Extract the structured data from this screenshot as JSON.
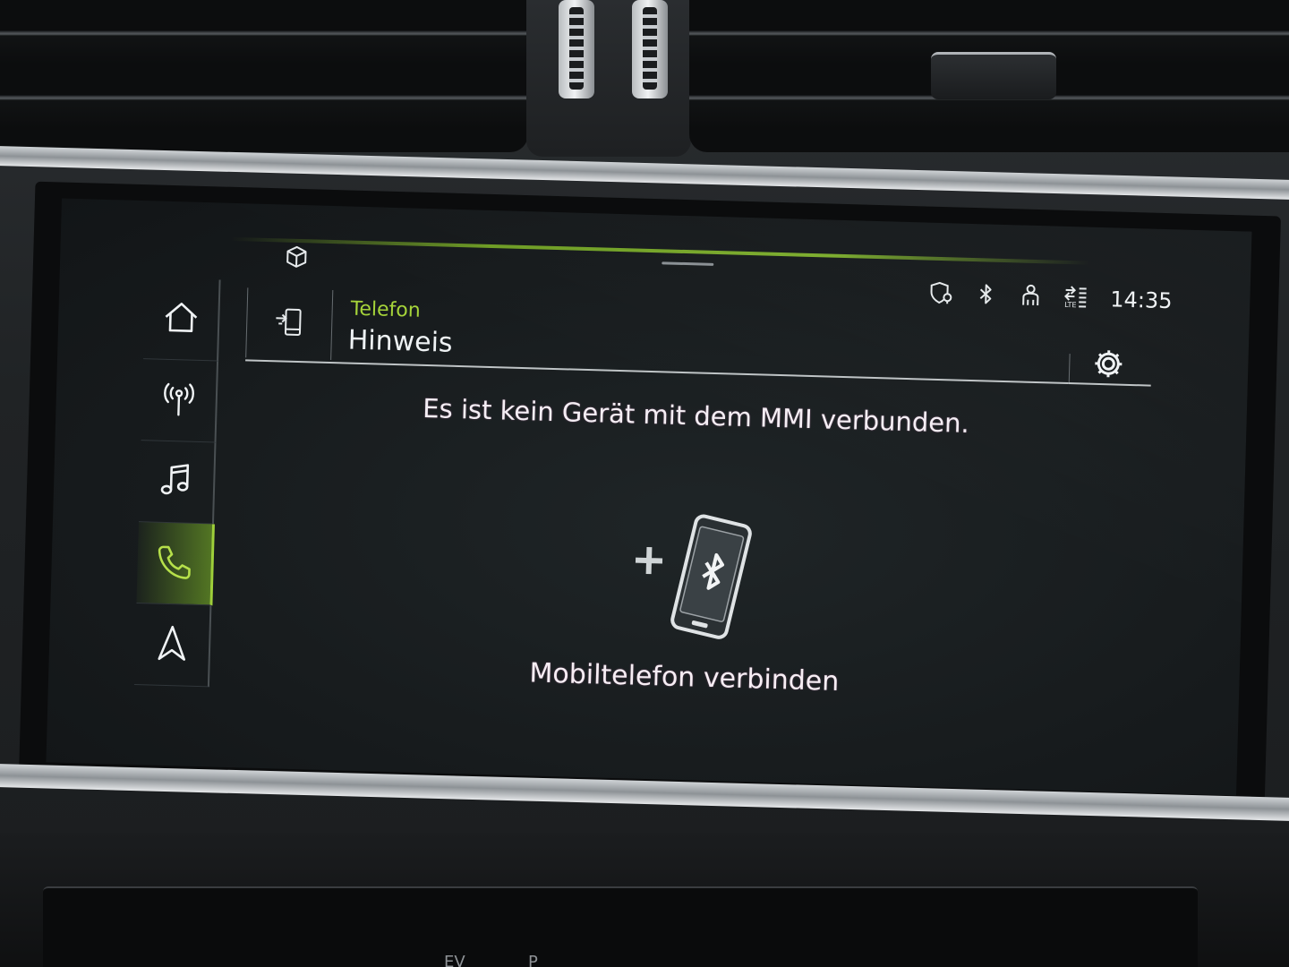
{
  "header": {
    "context": "Telefon",
    "title": "Hinweis"
  },
  "status_bar": {
    "time": "14:35",
    "icons": [
      "shield-location-icon",
      "bluetooth-icon",
      "person-icon",
      "lte-signal-icon"
    ]
  },
  "nav": {
    "items": [
      {
        "name": "home",
        "icon": "home-icon"
      },
      {
        "name": "radio",
        "icon": "radio-antenna-icon"
      },
      {
        "name": "media",
        "icon": "music-note-icon"
      },
      {
        "name": "phone",
        "icon": "phone-icon",
        "active": true
      },
      {
        "name": "navigation",
        "icon": "navigation-arrow-icon"
      }
    ]
  },
  "content": {
    "message": "Es ist kein Gerät mit dem MMI verbunden.",
    "connect_label": "Mobiltelefon verbinden"
  },
  "lower_screen": {
    "glyphs": [
      "EV",
      "P"
    ]
  },
  "colors": {
    "accent": "#a6d43a",
    "text": "#f4eef4",
    "screen_bg": "#1a1f21"
  }
}
